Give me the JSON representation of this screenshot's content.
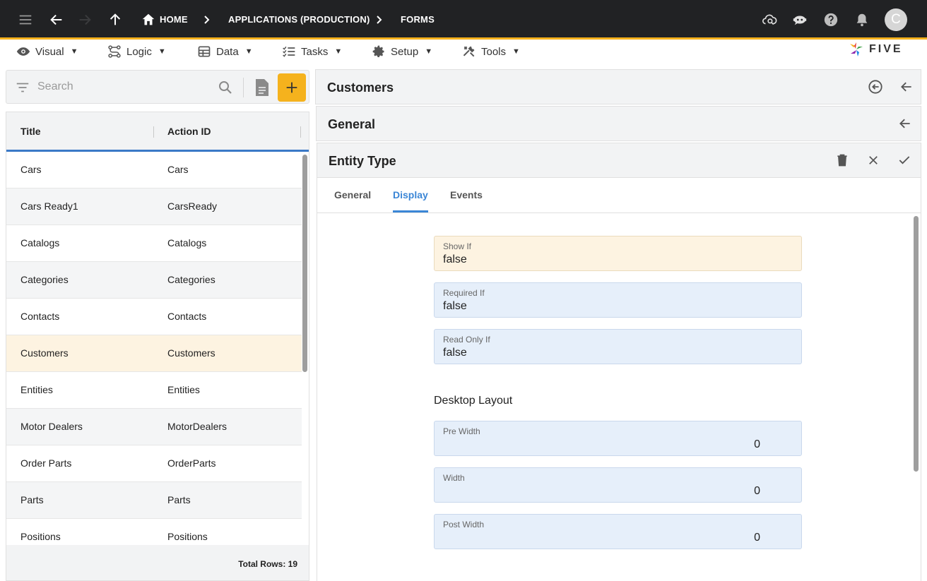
{
  "topbar": {
    "breadcrumbs": [
      "HOME",
      "APPLICATIONS (PRODUCTION)",
      "FORMS"
    ],
    "avatar_letter": "C",
    "icons": [
      "menu-icon",
      "back-arrow-icon",
      "forward-arrow-icon",
      "up-arrow-icon",
      "home-icon",
      "cloud-search-icon",
      "chat-bot-icon",
      "help-icon",
      "bell-icon"
    ]
  },
  "menubar": {
    "items": [
      "Visual",
      "Logic",
      "Data",
      "Tasks",
      "Setup",
      "Tools"
    ],
    "caret": "▼",
    "logo_text": "FIVE"
  },
  "search": {
    "placeholder": "Search"
  },
  "list": {
    "columns": [
      "Title",
      "Action ID"
    ],
    "rows": [
      {
        "title": "Cars",
        "action_id": "Cars"
      },
      {
        "title": "Cars Ready1",
        "action_id": "CarsReady"
      },
      {
        "title": "Catalogs",
        "action_id": "Catalogs"
      },
      {
        "title": "Categories",
        "action_id": "Categories"
      },
      {
        "title": "Contacts",
        "action_id": "Contacts"
      },
      {
        "title": "Customers",
        "action_id": "Customers"
      },
      {
        "title": "Entities",
        "action_id": "Entities"
      },
      {
        "title": "Motor Dealers",
        "action_id": "MotorDealers"
      },
      {
        "title": "Order Parts",
        "action_id": "OrderParts"
      },
      {
        "title": "Parts",
        "action_id": "Parts"
      },
      {
        "title": "Positions",
        "action_id": "Positions"
      }
    ],
    "selected_row": "Customers",
    "total_rows": "Total Rows: 19"
  },
  "panels": {
    "customers_title": "Customers",
    "general_title": "General",
    "entity_type_title": "Entity Type"
  },
  "tabs": [
    "General",
    "Display",
    "Events"
  ],
  "active_tab": "Display",
  "form": {
    "show_if": {
      "label": "Show If",
      "value": "false"
    },
    "required_if": {
      "label": "Required If",
      "value": "false"
    },
    "read_only_if": {
      "label": "Read Only If",
      "value": "false"
    },
    "desktop_layout_title": "Desktop Layout",
    "pre_width": {
      "label": "Pre Width",
      "value": "0"
    },
    "width": {
      "label": "Width",
      "value": "0"
    },
    "post_width": {
      "label": "Post Width",
      "value": "0"
    }
  },
  "colors": {
    "topbar_bg": "#212224",
    "accent": "#f5b21d",
    "active_tab": "#3b86d6",
    "field_bg": "#e6effa",
    "field_warn_bg": "#fdf3e1",
    "selected_row_bg": "#fdf3e1"
  }
}
